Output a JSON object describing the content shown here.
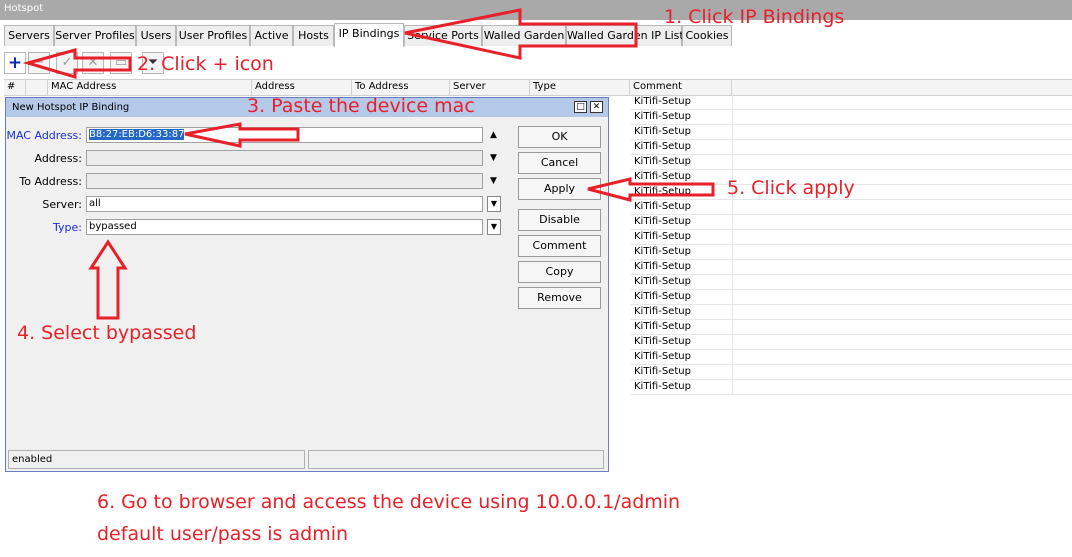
{
  "window": {
    "title": "Hotspot"
  },
  "tabs": [
    "Servers",
    "Server Profiles",
    "Users",
    "User Profiles",
    "Active",
    "Hosts",
    "IP Bindings",
    "Service Ports",
    "Walled Garden",
    "Walled Garden IP List",
    "Cookies"
  ],
  "active_tab": "IP Bindings",
  "toolbar": {
    "icons": [
      "plus-icon",
      "minus-icon",
      "check-icon",
      "cross-icon",
      "comment-icon",
      "filter-icon"
    ]
  },
  "table": {
    "columns": [
      "#",
      "MAC Address",
      "Address",
      "To Address",
      "Server",
      "Type",
      "Comment"
    ],
    "comments": [
      "KiTifi-Setup",
      "KiTifi-Setup",
      "KiTifi-Setup",
      "KiTifi-Setup",
      "KiTifi-Setup",
      "KiTifi-Setup",
      "KiTifi-Setup",
      "KiTifi-Setup",
      "KiTifi-Setup",
      "KiTifi-Setup",
      "KiTifi-Setup",
      "KiTifi-Setup",
      "KiTifi-Setup",
      "KiTifi-Setup",
      "KiTifi-Setup",
      "KiTifi-Setup",
      "KiTifi-Setup",
      "KiTifi-Setup",
      "KiTifi-Setup",
      "KiTifi-Setup"
    ]
  },
  "dialog": {
    "title": "New Hotspot IP Binding",
    "fields": {
      "mac_label": "MAC Address:",
      "mac_value": "B8:27:EB:D6:33:87",
      "address_label": "Address:",
      "address_value": "",
      "to_address_label": "To Address:",
      "to_address_value": "",
      "server_label": "Server:",
      "server_value": "all",
      "type_label": "Type:",
      "type_value": "bypassed"
    },
    "buttons": [
      "OK",
      "Cancel",
      "Apply",
      "Disable",
      "Comment",
      "Copy",
      "Remove"
    ],
    "status": "enabled"
  },
  "annotations": {
    "step1": "1. Click IP Bindings",
    "step2": "2. Click + icon",
    "step3": "3. Paste the device mac",
    "step4": "4. Select bypassed",
    "step5": "5. Click apply",
    "step6_line1": "6. Go to browser and access the device using 10.0.0.1/admin",
    "step6_line2": "default user/pass is admin"
  },
  "colors": {
    "annotation": "#e8202a",
    "selection": "#2467c4",
    "blue_label": "#1a2ed6"
  }
}
